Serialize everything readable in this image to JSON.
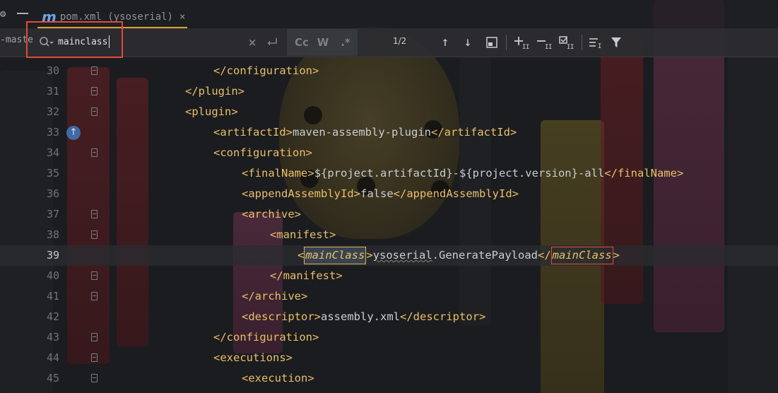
{
  "tabbar": {
    "tab": {
      "title": "pom.xml (ysoserial)",
      "close": "×",
      "file_icon": "m"
    }
  },
  "search": {
    "project_label": "-maste",
    "query": "mainclass",
    "match_count": "1/2",
    "buttons": {
      "match_case": "Cc",
      "words": "W",
      "regex": ".*"
    }
  },
  "editor": {
    "lines": [
      {
        "num": "30"
      },
      {
        "num": "31"
      },
      {
        "num": "32"
      },
      {
        "num": "33"
      },
      {
        "num": "34"
      },
      {
        "num": "35"
      },
      {
        "num": "36"
      },
      {
        "num": "37"
      },
      {
        "num": "38"
      },
      {
        "num": "39"
      },
      {
        "num": "40"
      },
      {
        "num": "41"
      },
      {
        "num": "42"
      },
      {
        "num": "43"
      },
      {
        "num": "44"
      },
      {
        "num": "45"
      }
    ],
    "code": {
      "l30_tag": "configuration",
      "l31_tag": "plugin",
      "l32_tag": "plugin",
      "l33_tag": "artifactId",
      "l33_text": "maven-assembly-plugin",
      "l34_tag": "configuration",
      "l35_tag": "finalName",
      "l35_text": "${project.artifactId}-${project.version}-all",
      "l36_tag": "appendAssemblyId",
      "l36_text": "false",
      "l37_tag": "archive",
      "l38_tag": "manifest",
      "l39_tag": "mainClass",
      "l39_text_a": "ysoserial",
      "l39_text_b": ".GeneratePayload",
      "l40_tag": "manifest",
      "l41_tag": "archive",
      "l42_tag": "descriptor",
      "l42_text": "assembly.xml",
      "l43_tag": "configuration",
      "l44_tag": "executions",
      "l45_tag": "execution"
    }
  },
  "colors": {
    "tag": "#e8bf6a",
    "text": "#c9ccd1",
    "line_number": "#70737a",
    "search_highlight_border": "#e04a3e",
    "tab_underline": "#d9a03a",
    "file_icon": "#6aa4e8"
  }
}
